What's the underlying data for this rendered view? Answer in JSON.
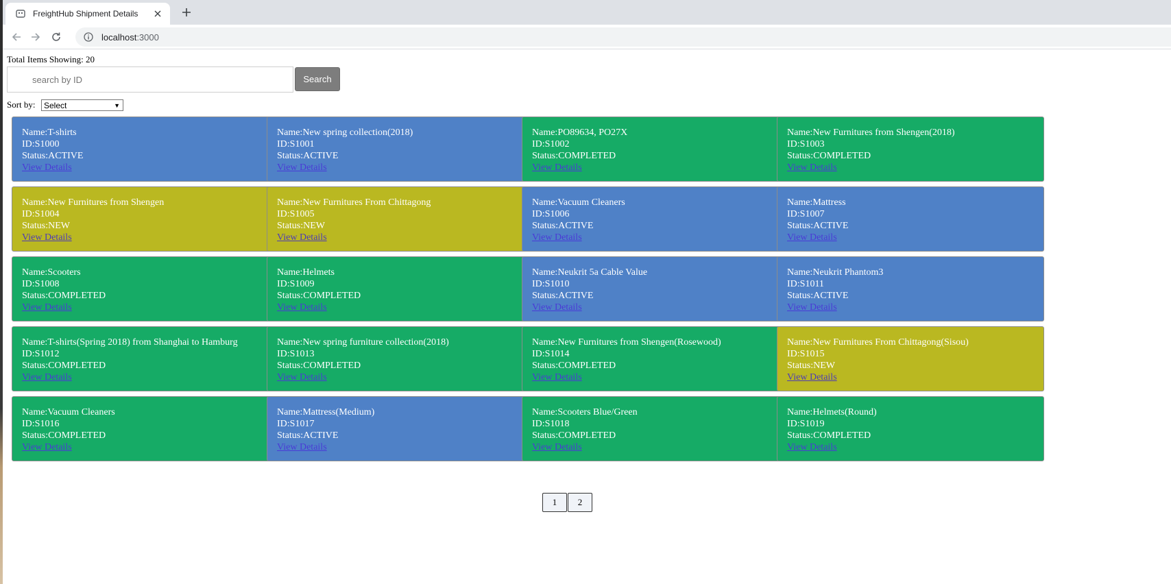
{
  "browser": {
    "tab_title": "FreightHub Shipment Details",
    "url_host": "localhost",
    "url_port": ":3000"
  },
  "page": {
    "total_label": "Total Items Showing: 20",
    "search_placeholder": "search by ID",
    "search_button": "Search",
    "sort_label": "Sort by:",
    "sort_selected": "Select"
  },
  "status_colors": {
    "ACTIVE": "#4f81c7",
    "COMPLETED": "#16ab66",
    "NEW": "#bab821"
  },
  "link_label": "View Details",
  "shipments": [
    {
      "name": "Name:T-shirts",
      "id": "ID:S1000",
      "status": "Status:ACTIVE",
      "state": "ACTIVE"
    },
    {
      "name": "Name:New spring collection(2018)",
      "id": "ID:S1001",
      "status": "Status:ACTIVE",
      "state": "ACTIVE"
    },
    {
      "name": "Name:PO89634, PO27X",
      "id": "ID:S1002",
      "status": "Status:COMPLETED",
      "state": "COMPLETED"
    },
    {
      "name": "Name:New Furnitures from Shengen(2018)",
      "id": "ID:S1003",
      "status": "Status:COMPLETED",
      "state": "COMPLETED"
    },
    {
      "name": "Name:New Furnitures from Shengen",
      "id": "ID:S1004",
      "status": "Status:NEW",
      "state": "NEW"
    },
    {
      "name": "Name:New Furnitures From Chittagong",
      "id": "ID:S1005",
      "status": "Status:NEW",
      "state": "NEW"
    },
    {
      "name": "Name:Vacuum Cleaners",
      "id": "ID:S1006",
      "status": "Status:ACTIVE",
      "state": "ACTIVE"
    },
    {
      "name": "Name:Mattress",
      "id": "ID:S1007",
      "status": "Status:ACTIVE",
      "state": "ACTIVE"
    },
    {
      "name": "Name:Scooters",
      "id": "ID:S1008",
      "status": "Status:COMPLETED",
      "state": "COMPLETED"
    },
    {
      "name": "Name:Helmets",
      "id": "ID:S1009",
      "status": "Status:COMPLETED",
      "state": "COMPLETED"
    },
    {
      "name": "Name:Neukrit 5a Cable Value",
      "id": "ID:S1010",
      "status": "Status:ACTIVE",
      "state": "ACTIVE"
    },
    {
      "name": "Name:Neukrit Phantom3",
      "id": "ID:S1011",
      "status": "Status:ACTIVE",
      "state": "ACTIVE"
    },
    {
      "name": "Name:T-shirts(Spring 2018) from Shanghai to Hamburg",
      "id": "ID:S1012",
      "status": "Status:COMPLETED",
      "state": "COMPLETED"
    },
    {
      "name": "Name:New spring furniture collection(2018)",
      "id": "ID:S1013",
      "status": "Status:COMPLETED",
      "state": "COMPLETED"
    },
    {
      "name": "Name:New Furnitures from Shengen(Rosewood)",
      "id": "ID:S1014",
      "status": "Status:COMPLETED",
      "state": "COMPLETED"
    },
    {
      "name": "Name:New Furnitures From Chittagong(Sisou)",
      "id": "ID:S1015",
      "status": "Status:NEW",
      "state": "NEW"
    },
    {
      "name": "Name:Vacuum Cleaners",
      "id": "ID:S1016",
      "status": "Status:COMPLETED",
      "state": "COMPLETED"
    },
    {
      "name": "Name:Mattress(Medium)",
      "id": "ID:S1017",
      "status": "Status:ACTIVE",
      "state": "ACTIVE"
    },
    {
      "name": "Name:Scooters Blue/Green",
      "id": "ID:S1018",
      "status": "Status:COMPLETED",
      "state": "COMPLETED"
    },
    {
      "name": "Name:Helmets(Round)",
      "id": "ID:S1019",
      "status": "Status:COMPLETED",
      "state": "COMPLETED"
    }
  ],
  "pagination": [
    "1",
    "2"
  ]
}
